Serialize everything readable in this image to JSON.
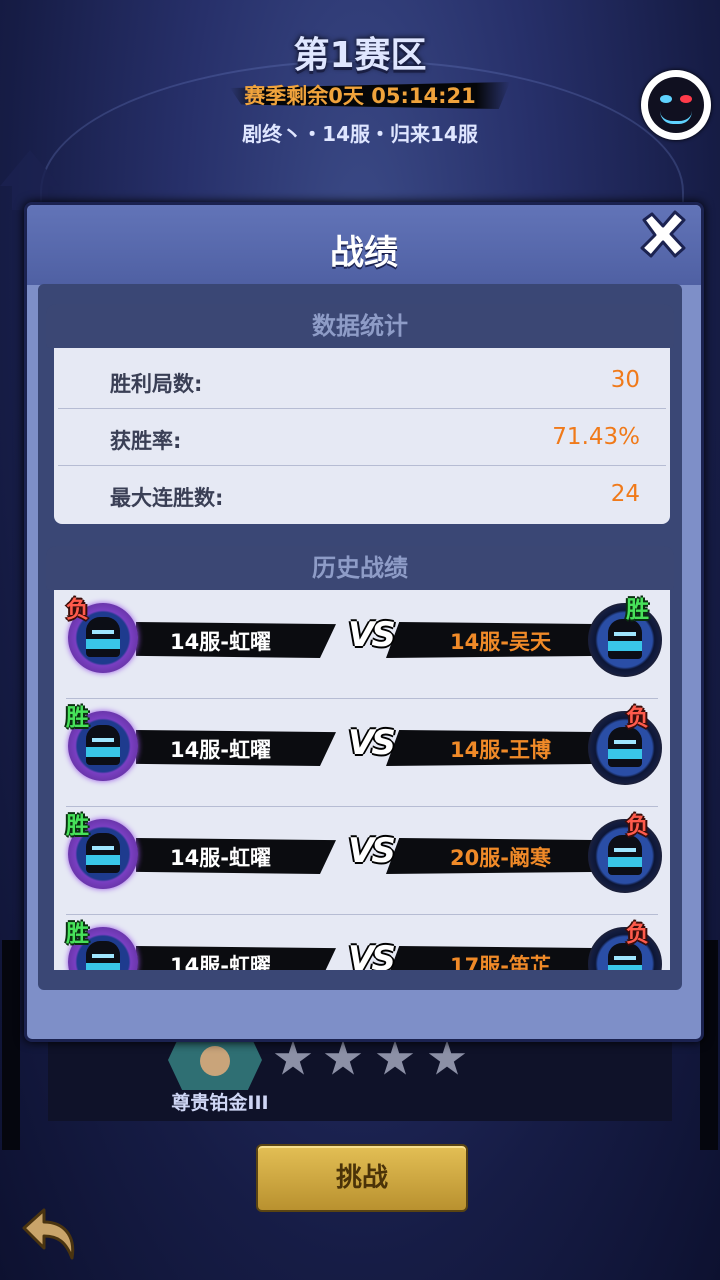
{
  "header": {
    "title": "第1赛区",
    "season_timer": "赛季剩余0天 05:14:21",
    "team_line": "剧终丶・14服・归来14服"
  },
  "dialog": {
    "title": "战绩",
    "stats_section": "数据统计",
    "stats": [
      {
        "label": "胜利局数:",
        "value": "30"
      },
      {
        "label": "获胜率:",
        "value": "71.43%"
      },
      {
        "label": "最大连胜数:",
        "value": "24"
      }
    ],
    "history_section": "历史战绩",
    "vs_label": "VS",
    "matches": [
      {
        "left_result": "负",
        "left_name": "14服-虹曜",
        "right_result": "胜",
        "right_name": "14服-吴天"
      },
      {
        "left_result": "胜",
        "left_name": "14服-虹曜",
        "right_result": "负",
        "right_name": "14服-王博"
      },
      {
        "left_result": "胜",
        "left_name": "14服-虹曜",
        "right_result": "负",
        "right_name": "20服-阚寒"
      },
      {
        "left_result": "胜",
        "left_name": "14服-虹曜",
        "right_result": "负",
        "right_name": "17服-笛芷"
      }
    ]
  },
  "rank": {
    "name": "尊贵铂金III",
    "stars_filled": 0,
    "stars_total": 4
  },
  "actions": {
    "challenge_label": "挑战"
  },
  "colors": {
    "win": "#47e25a",
    "lose": "#ff5b4c",
    "accent": "#f07a1a"
  },
  "icons": [
    "close-icon",
    "back-arrow-icon",
    "player-avatar-icon",
    "rank-badge-icon",
    "star-icon"
  ]
}
